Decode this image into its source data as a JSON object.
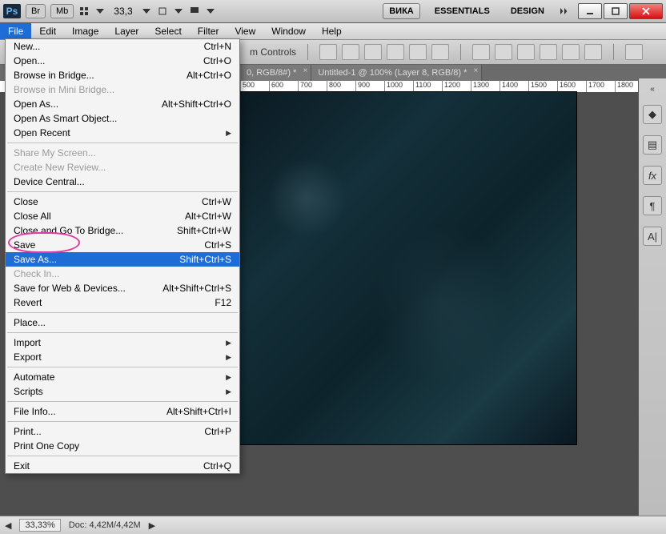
{
  "titlebar": {
    "ps": "Ps",
    "br": "Br",
    "mb": "Mb",
    "zoom1": "33,3",
    "workspaces": [
      "ВИКА",
      "ESSENTIALS",
      "DESIGN"
    ],
    "active_ws": 0
  },
  "menubar": [
    "File",
    "Edit",
    "Image",
    "Layer",
    "Select",
    "Filter",
    "View",
    "Window",
    "Help"
  ],
  "optbar": {
    "controls_label": "m Controls"
  },
  "doctabs": [
    {
      "label": "0, RGB/8#) *"
    },
    {
      "label": "Untitled-1 @ 100% (Layer 8, RGB/8) *"
    }
  ],
  "ruler_marks": [
    "500",
    "600",
    "700",
    "800",
    "900",
    "1000",
    "1100",
    "1200",
    "1300",
    "1400",
    "1500",
    "1600",
    "1700",
    "1800"
  ],
  "status": {
    "pct": "33,33%",
    "doc": "Doc: 4,42M/4,42M"
  },
  "file_menu": [
    {
      "label": "New...",
      "shortcut": "Ctrl+N"
    },
    {
      "label": "Open...",
      "shortcut": "Ctrl+O"
    },
    {
      "label": "Browse in Bridge...",
      "shortcut": "Alt+Ctrl+O"
    },
    {
      "label": "Browse in Mini Bridge...",
      "disabled": true
    },
    {
      "label": "Open As...",
      "shortcut": "Alt+Shift+Ctrl+O"
    },
    {
      "label": "Open As Smart Object..."
    },
    {
      "label": "Open Recent",
      "submenu": true
    },
    {
      "sep": true
    },
    {
      "label": "Share My Screen...",
      "disabled": true
    },
    {
      "label": "Create New Review...",
      "disabled": true
    },
    {
      "label": "Device Central..."
    },
    {
      "sep": true
    },
    {
      "label": "Close",
      "shortcut": "Ctrl+W"
    },
    {
      "label": "Close All",
      "shortcut": "Alt+Ctrl+W"
    },
    {
      "label": "Close and Go To Bridge...",
      "shortcut": "Shift+Ctrl+W"
    },
    {
      "label": "Save",
      "shortcut": "Ctrl+S"
    },
    {
      "label": "Save As...",
      "shortcut": "Shift+Ctrl+S",
      "highlight": true
    },
    {
      "label": "Check In...",
      "disabled": true
    },
    {
      "label": "Save for Web & Devices...",
      "shortcut": "Alt+Shift+Ctrl+S"
    },
    {
      "label": "Revert",
      "shortcut": "F12"
    },
    {
      "sep": true
    },
    {
      "label": "Place..."
    },
    {
      "sep": true
    },
    {
      "label": "Import",
      "submenu": true
    },
    {
      "label": "Export",
      "submenu": true
    },
    {
      "sep": true
    },
    {
      "label": "Automate",
      "submenu": true
    },
    {
      "label": "Scripts",
      "submenu": true
    },
    {
      "sep": true
    },
    {
      "label": "File Info...",
      "shortcut": "Alt+Shift+Ctrl+I"
    },
    {
      "sep": true
    },
    {
      "label": "Print...",
      "shortcut": "Ctrl+P"
    },
    {
      "label": "Print One Copy"
    },
    {
      "sep": true
    },
    {
      "label": "Exit",
      "shortcut": "Ctrl+Q"
    }
  ],
  "dock_icons": [
    "layers-icon",
    "channels-icon",
    "fx-icon",
    "paragraph-icon",
    "character-icon"
  ]
}
